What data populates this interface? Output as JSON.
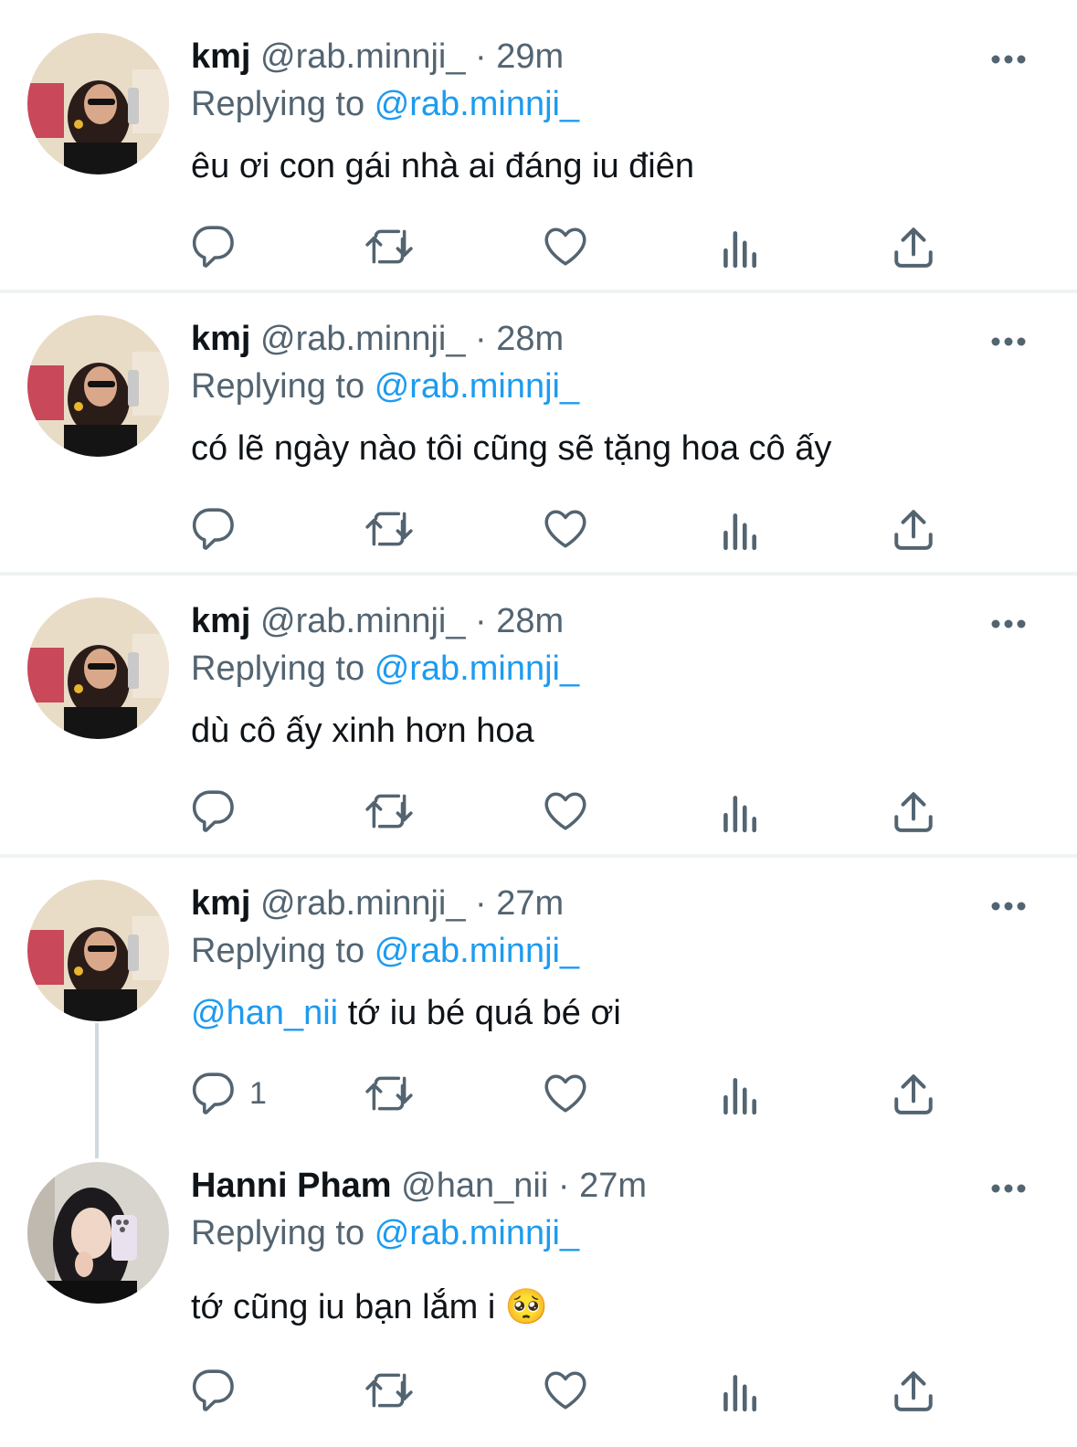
{
  "tweets": [
    {
      "name": "kmj",
      "handle": "@rab.minnji_",
      "separator": "·",
      "time": "29m",
      "replying_prefix": "Replying to",
      "replying_to": "@rab.minnji_",
      "text": "êu ơi con gái nhà ai đáng iu điên",
      "text_mention": "",
      "reply_count": ""
    },
    {
      "name": "kmj",
      "handle": "@rab.minnji_",
      "separator": "·",
      "time": "28m",
      "replying_prefix": "Replying to",
      "replying_to": "@rab.minnji_",
      "text": "có lẽ ngày nào tôi cũng sẽ tặng hoa cô ấy",
      "text_mention": "",
      "reply_count": ""
    },
    {
      "name": "kmj",
      "handle": "@rab.minnji_",
      "separator": "·",
      "time": "28m",
      "replying_prefix": "Replying to",
      "replying_to": "@rab.minnji_",
      "text": "dù cô ấy xinh hơn hoa",
      "text_mention": "",
      "reply_count": ""
    },
    {
      "name": "kmj",
      "handle": "@rab.minnji_",
      "separator": "·",
      "time": "27m",
      "replying_prefix": "Replying to",
      "replying_to": "@rab.minnji_",
      "text_mention": "@han_nii",
      "text": " tớ iu bé quá bé ơi",
      "reply_count": "1"
    },
    {
      "name": "Hanni Pham",
      "handle": "@han_nii",
      "separator": "·",
      "time": "27m",
      "replying_prefix": "Replying to",
      "replying_to": "@rab.minnji_",
      "text": "tớ cũng iu bạn lắm i",
      "emoji": "🥺",
      "text_mention": "",
      "reply_count": ""
    }
  ],
  "icons": {
    "reply": "reply-icon",
    "retweet": "retweet-icon",
    "like": "heart-icon",
    "views": "views-icon",
    "share": "share-icon",
    "more": "more-icon"
  },
  "colors": {
    "link": "#1d9bf0",
    "secondary_text": "#536471",
    "primary_text": "#0f1419",
    "divider": "#eff3f4",
    "thread_line": "#cfd9de"
  }
}
